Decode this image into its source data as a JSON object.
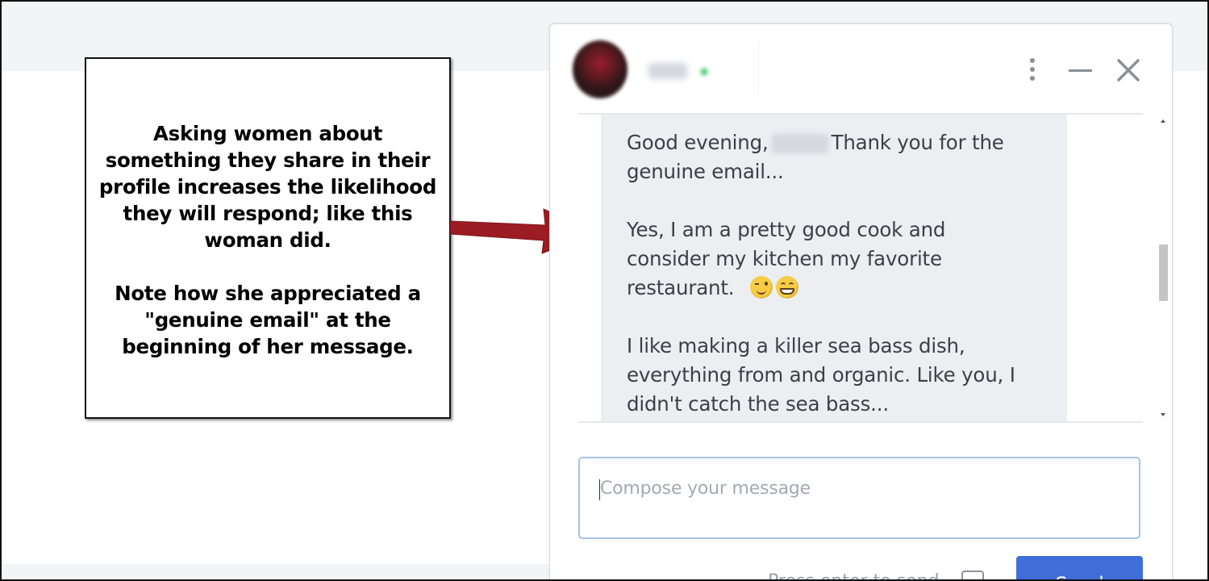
{
  "annotation": {
    "paragraph1_lines": [
      "Asking women about",
      "something they share in their",
      "profile increases the likelihood",
      "they will respond; like this",
      "woman did."
    ],
    "paragraph2_lines": [
      "Note how she appreciated a",
      "\"genuine email\" at the",
      "beginning of her message."
    ],
    "arrow_color": "#9b1c23"
  },
  "chat": {
    "header": {
      "menu_icon": "kebab-menu-icon",
      "minimize_icon": "minimize-icon",
      "close_icon": "close-icon"
    },
    "message": {
      "line1_before": "Good evening,",
      "line1_after": "Thank you for the",
      "line2": "genuine email...",
      "line3": "Yes, I am a pretty good cook and",
      "line4": "consider my kitchen my favorite",
      "line5": "restaurant.",
      "emojis": [
        "winking-face-emoji",
        "grinning-face-emoji"
      ],
      "line6": "I like making a killer sea bass dish,",
      "line7": "everything from and organic. Like you, I",
      "line8": "didn't catch the sea bass..."
    },
    "compose": {
      "placeholder": "Compose your message"
    },
    "footer": {
      "enter_label": "Press enter to send",
      "send_label": "Send"
    }
  },
  "colors": {
    "accent": "#3f6ed8",
    "bubble": "#eceef2",
    "arrow": "#9b1c23"
  }
}
